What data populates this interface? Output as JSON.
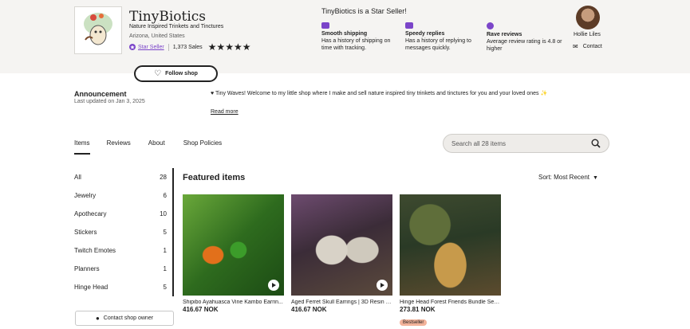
{
  "shop": {
    "name": "TinyBiotics",
    "tagline": "Nature Inspired Trinkets and Tinctures",
    "location": "Arizona, United States",
    "star_seller_label": "Star Seller",
    "sales": "1,373 Sales",
    "stars": "★★★★★",
    "follow_label": "Follow shop"
  },
  "star_seller": {
    "title": "TinyBiotics is a Star Seller!",
    "features": [
      {
        "title": "Smooth shipping",
        "desc": "Has a history of shipping on time with tracking."
      },
      {
        "title": "Speedy replies",
        "desc": "Has a history of replying to messages quickly."
      },
      {
        "title": "Rave reviews",
        "desc": "Average review rating is 4.8 or higher"
      }
    ]
  },
  "owner": {
    "name": "Hollie Liles",
    "contact_label": "Contact"
  },
  "announcement": {
    "title": "Announcement",
    "date": "Last updated on Jan 3, 2025",
    "text": "♥ Tiny Waves! Welcome to my little shop where I make and sell nature inspired tiny trinkets and tinctures for you and your loved ones ✨",
    "read_more": "Read more"
  },
  "tabs": [
    "Items",
    "Reviews",
    "About",
    "Shop Policies"
  ],
  "search": {
    "placeholder": "Search all 28 items"
  },
  "categories": [
    {
      "label": "All",
      "count": "28"
    },
    {
      "label": "Jewelry",
      "count": "6"
    },
    {
      "label": "Apothecary",
      "count": "10"
    },
    {
      "label": "Stickers",
      "count": "5"
    },
    {
      "label": "Twitch Emotes",
      "count": "1"
    },
    {
      "label": "Planners",
      "count": "1"
    },
    {
      "label": "Hinge Head",
      "count": "5"
    }
  ],
  "contact_owner_label": "Contact shop owner",
  "featured": {
    "title": "Featured items",
    "sort_label": "Sort: Most Recent",
    "items": [
      {
        "title": "Shipibo Ayahuasca Vine Kambo Earrin...",
        "price": "416.67 NOK",
        "video": true
      },
      {
        "title": "Aged Ferret Skull Earrings | 3D Resin P...",
        "price": "416.67 NOK",
        "video": true
      },
      {
        "title": "Hinge Head Forest Friends Bundle Set ...",
        "price": "273.81 NOK",
        "badge": "Bestseller"
      }
    ]
  },
  "colors": {
    "accent": "#7b45c9",
    "badge": "#f3b39a",
    "header_bg": "#f5f4f2"
  }
}
